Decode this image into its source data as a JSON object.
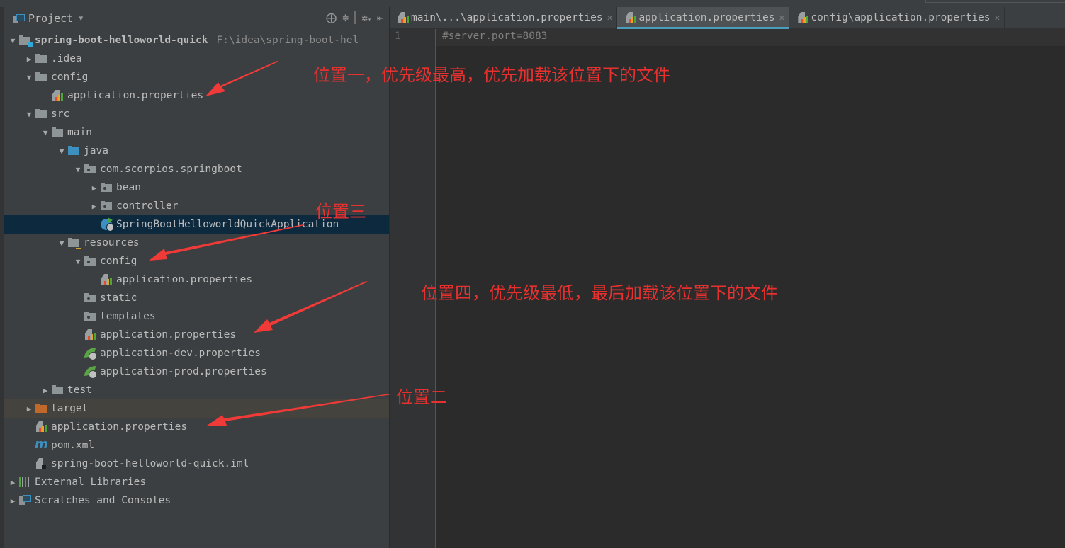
{
  "sidebar": {
    "title": "Project",
    "tools": [
      "locate-icon",
      "collapse-all-icon",
      "settings-icon",
      "hide-icon"
    ],
    "tree": [
      {
        "label": "spring-boot-helloworld-quick",
        "path": "F:\\idea\\spring-boot-hel",
        "kind": "module",
        "depth": 0,
        "arrow": "down",
        "bold": true
      },
      {
        "label": ".idea",
        "kind": "folder",
        "depth": 1,
        "arrow": "right"
      },
      {
        "label": "config",
        "kind": "folder",
        "depth": 1,
        "arrow": "down"
      },
      {
        "label": "application.properties",
        "kind": "properties",
        "depth": 2,
        "arrow": ""
      },
      {
        "label": "src",
        "kind": "folder",
        "depth": 1,
        "arrow": "down"
      },
      {
        "label": "main",
        "kind": "folder",
        "depth": 2,
        "arrow": "down"
      },
      {
        "label": "java",
        "kind": "java",
        "depth": 3,
        "arrow": "down"
      },
      {
        "label": "com.scorpios.springboot",
        "kind": "package",
        "depth": 4,
        "arrow": "down"
      },
      {
        "label": "bean",
        "kind": "package",
        "depth": 5,
        "arrow": "right"
      },
      {
        "label": "controller",
        "kind": "package",
        "depth": 5,
        "arrow": "right"
      },
      {
        "label": "SpringBootHelloworldQuickApplication",
        "kind": "appclass",
        "depth": 5,
        "arrow": "",
        "selected": true
      },
      {
        "label": "resources",
        "kind": "resources",
        "depth": 3,
        "arrow": "down"
      },
      {
        "label": "config",
        "kind": "package",
        "depth": 4,
        "arrow": "down"
      },
      {
        "label": "application.properties",
        "kind": "properties",
        "depth": 5,
        "arrow": ""
      },
      {
        "label": "static",
        "kind": "package",
        "depth": 4,
        "arrow": ""
      },
      {
        "label": "templates",
        "kind": "package",
        "depth": 4,
        "arrow": ""
      },
      {
        "label": "application.properties",
        "kind": "properties",
        "depth": 4,
        "arrow": ""
      },
      {
        "label": "application-dev.properties",
        "kind": "spring",
        "depth": 4,
        "arrow": ""
      },
      {
        "label": "application-prod.properties",
        "kind": "spring",
        "depth": 4,
        "arrow": ""
      },
      {
        "label": "test",
        "kind": "folder",
        "depth": 2,
        "arrow": "right"
      },
      {
        "label": "target",
        "kind": "target",
        "depth": 1,
        "arrow": "right",
        "excluded": true
      },
      {
        "label": "application.properties",
        "kind": "properties",
        "depth": 1,
        "arrow": ""
      },
      {
        "label": "pom.xml",
        "kind": "maven",
        "depth": 1,
        "arrow": ""
      },
      {
        "label": "spring-boot-helloworld-quick.iml",
        "kind": "iml",
        "depth": 1,
        "arrow": ""
      },
      {
        "label": "External Libraries",
        "kind": "libraries",
        "depth": 0,
        "arrow": "right"
      },
      {
        "label": "Scratches and Consoles",
        "kind": "scratches",
        "depth": 0,
        "arrow": "right"
      }
    ]
  },
  "tabs": [
    {
      "label": "main\\...\\application.properties",
      "active": false
    },
    {
      "label": "application.properties",
      "active": true
    },
    {
      "label": "config\\application.properties",
      "active": false
    }
  ],
  "editor": {
    "line_numbers": [
      "1"
    ],
    "lines": [
      "#server.port=8083"
    ]
  },
  "annotations": {
    "pos1": "位置一，优先级最高，优先加载该位置下的文件",
    "pos2": "位置二",
    "pos3": "位置三",
    "pos4": "位置四，优先级最低，最后加载该位置下的文件"
  },
  "colors": {
    "annotation": "#e8312f",
    "tab_active_underline": "#4a9dbb",
    "selection": "#0d293e"
  }
}
